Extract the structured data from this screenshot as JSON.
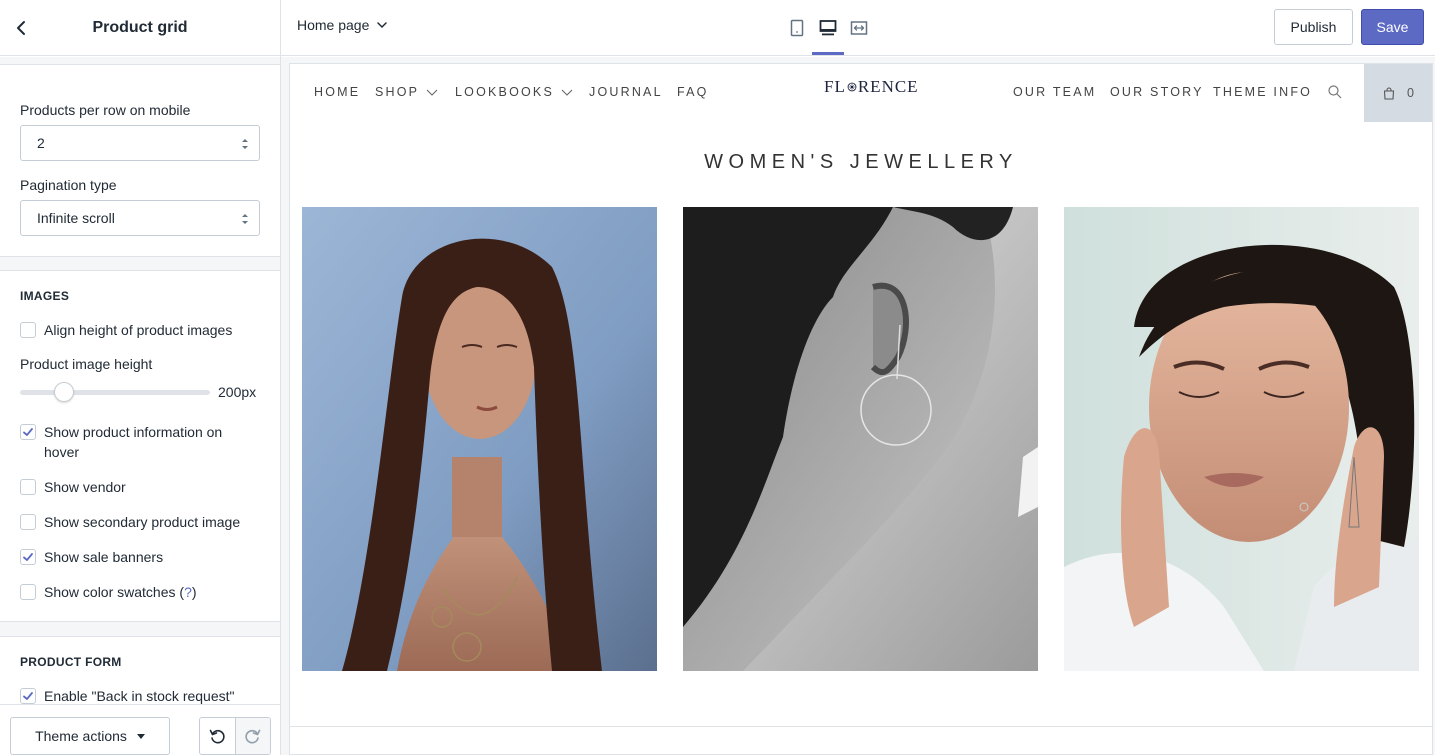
{
  "sidebar": {
    "title": "Product grid",
    "fields": {
      "products_per_row_label": "Products per row on mobile",
      "products_per_row_value": "2",
      "pagination_label": "Pagination type",
      "pagination_value": "Infinite scroll"
    },
    "images_section": {
      "heading": "IMAGES",
      "align_height_label": "Align height of product images",
      "align_height_checked": false,
      "image_height_label": "Product image height",
      "image_height_value": "200px",
      "show_info_hover_label": "Show product information on hover",
      "show_info_hover_checked": true,
      "show_vendor_label": "Show vendor",
      "show_vendor_checked": false,
      "show_secondary_label": "Show secondary product image",
      "show_secondary_checked": false,
      "show_sale_label": "Show sale banners",
      "show_sale_checked": true,
      "show_swatches_label": "Show color swatches (",
      "show_swatches_help": "?",
      "show_swatches_after": ")",
      "show_swatches_checked": false
    },
    "product_form_section": {
      "heading": "PRODUCT FORM",
      "back_in_stock_label": "Enable \"Back in stock request\"",
      "back_in_stock_checked": true
    },
    "footer": {
      "theme_actions_label": "Theme actions"
    }
  },
  "topbar": {
    "page_select_label": "Home page",
    "publish_label": "Publish",
    "save_label": "Save",
    "active_device": "desktop"
  },
  "preview": {
    "nav_left": [
      "HOME",
      "SHOP",
      "LOOKBOOKS",
      "JOURNAL",
      "FAQ"
    ],
    "logo_before": "FL",
    "logo_after": "RENCE",
    "nav_right": [
      "OUR TEAM",
      "OUR STORY",
      "THEME INFO"
    ],
    "cart_count": "0",
    "collection_title": "WOMEN'S JEWELLERY"
  },
  "colors": {
    "accent": "#5c6ac4",
    "border": "#dfe3e8",
    "text": "#212b36",
    "cart_bg": "#d5dbe3"
  }
}
